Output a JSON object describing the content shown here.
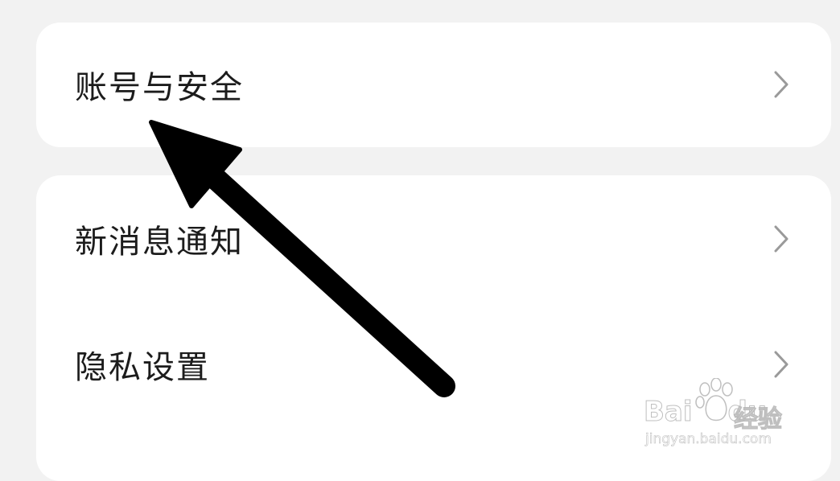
{
  "settings": {
    "groups": [
      {
        "items": [
          {
            "label": "账号与安全",
            "icon": "chevron-right-icon"
          }
        ]
      },
      {
        "items": [
          {
            "label": "新消息通知",
            "icon": "chevron-right-icon"
          },
          {
            "label": "隐私设置",
            "icon": "chevron-right-icon"
          }
        ]
      }
    ]
  },
  "annotation": {
    "type": "arrow",
    "points_to": "账号与安全",
    "color": "#000000"
  },
  "watermark": {
    "brand_latin": "Bai",
    "brand_latin2": "du",
    "brand_cn": "经验",
    "url": "jingyan.baidu.com",
    "icon": "paw-icon"
  },
  "colors": {
    "background": "#f2f2f2",
    "card": "#ffffff",
    "text": "#1c1c1c",
    "chevron": "#9a9a9a"
  }
}
